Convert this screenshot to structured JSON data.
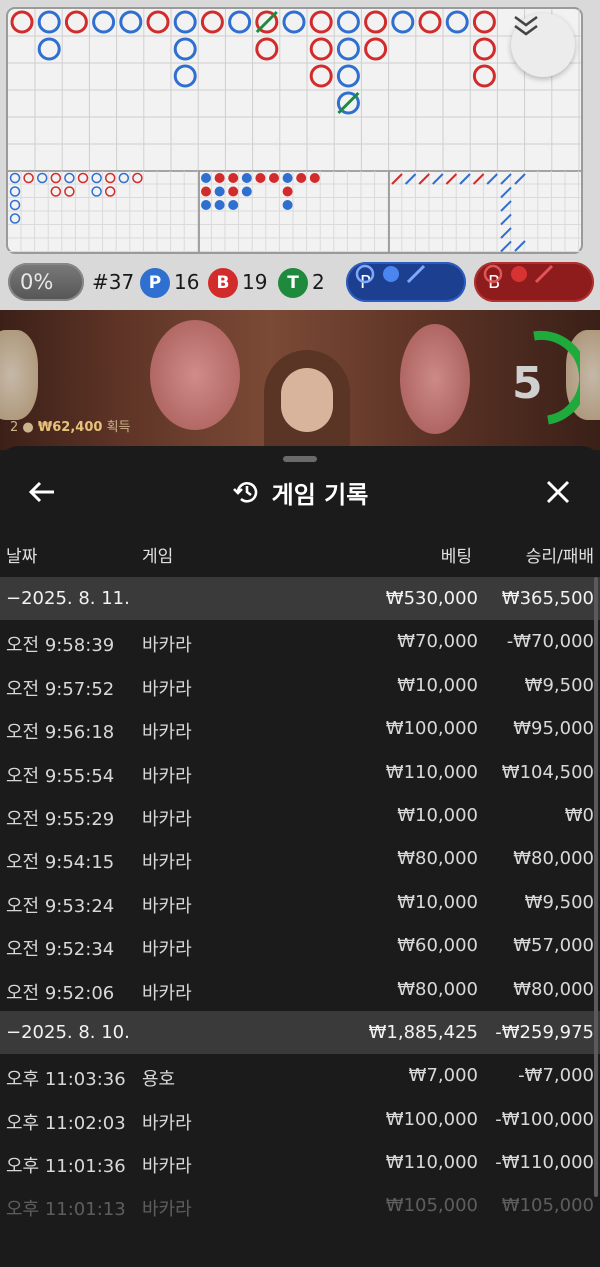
{
  "board": {
    "percent": "0%",
    "round": "#37",
    "player": {
      "letter": "P",
      "count": "16",
      "color": "#2f6fd0"
    },
    "banker": {
      "letter": "B",
      "count": "19",
      "color": "#d22b2b"
    },
    "tie": {
      "letter": "T",
      "count": "2",
      "color": "#1f8a3e"
    },
    "predict_player_label": "P",
    "predict_banker_label": "B"
  },
  "video": {
    "timer": "5",
    "winners": "2",
    "win_amount": "₩62,400",
    "win_suffix": "획득"
  },
  "panel": {
    "title": "게임 기록",
    "columns": {
      "date": "날짜",
      "game": "게임",
      "bet": "베팅",
      "result": "승리/패배"
    }
  },
  "history": [
    {
      "type": "group",
      "date": "−2025. 8. 11.",
      "bet": "₩530,000",
      "result": "₩365,500"
    },
    {
      "type": "entry",
      "time": "오전 9:58:39",
      "game": "바카라",
      "bet": "₩70,000",
      "result": "-₩70,000"
    },
    {
      "type": "entry",
      "time": "오전 9:57:52",
      "game": "바카라",
      "bet": "₩10,000",
      "result": "₩9,500"
    },
    {
      "type": "entry",
      "time": "오전 9:56:18",
      "game": "바카라",
      "bet": "₩100,000",
      "result": "₩95,000"
    },
    {
      "type": "entry",
      "time": "오전 9:55:54",
      "game": "바카라",
      "bet": "₩110,000",
      "result": "₩104,500"
    },
    {
      "type": "entry",
      "time": "오전 9:55:29",
      "game": "바카라",
      "bet": "₩10,000",
      "result": "₩0"
    },
    {
      "type": "entry",
      "time": "오전 9:54:15",
      "game": "바카라",
      "bet": "₩80,000",
      "result": "₩80,000"
    },
    {
      "type": "entry",
      "time": "오전 9:53:24",
      "game": "바카라",
      "bet": "₩10,000",
      "result": "₩9,500"
    },
    {
      "type": "entry",
      "time": "오전 9:52:34",
      "game": "바카라",
      "bet": "₩60,000",
      "result": "₩57,000"
    },
    {
      "type": "entry",
      "time": "오전 9:52:06",
      "game": "바카라",
      "bet": "₩80,000",
      "result": "₩80,000"
    },
    {
      "type": "group",
      "date": "−2025. 8. 10.",
      "bet": "₩1,885,425",
      "result": "-₩259,975"
    },
    {
      "type": "entry",
      "time": "오후 11:03:36",
      "game": "용호",
      "bet": "₩7,000",
      "result": "-₩7,000"
    },
    {
      "type": "entry",
      "time": "오후 11:02:03",
      "game": "바카라",
      "bet": "₩100,000",
      "result": "-₩100,000"
    },
    {
      "type": "entry",
      "time": "오후 11:01:36",
      "game": "바카라",
      "bet": "₩110,000",
      "result": "-₩110,000"
    },
    {
      "type": "entry",
      "time": "오후 11:01:13",
      "game": "바카라",
      "bet": "₩105,000",
      "result": "₩105,000"
    }
  ]
}
